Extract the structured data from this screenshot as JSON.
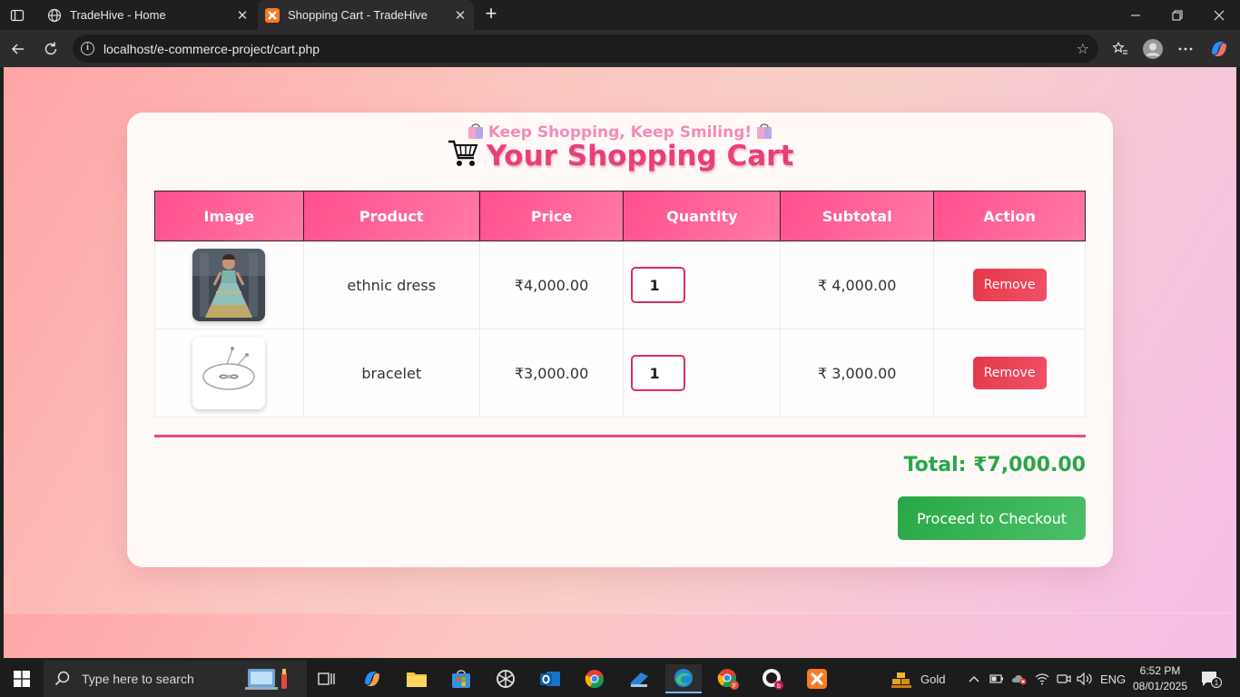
{
  "browser": {
    "tabs": [
      {
        "title": "TradeHive - Home",
        "active": false
      },
      {
        "title": "Shopping Cart - TradeHive",
        "active": true
      }
    ],
    "url": "localhost/e-commerce-project/cart.php"
  },
  "page": {
    "tagline": "Keep Shopping, Keep Smiling!",
    "heading": "Your Shopping Cart",
    "columns": [
      "Image",
      "Product",
      "Price",
      "Quantity",
      "Subtotal",
      "Action"
    ],
    "rows": [
      {
        "product": "ethnic dress",
        "price": "₹4,000.00",
        "quantity": "1",
        "subtotal": "₹ 4,000.00",
        "action": "Remove"
      },
      {
        "product": "bracelet",
        "price": "₹3,000.00",
        "quantity": "1",
        "subtotal": "₹ 3,000.00",
        "action": "Remove"
      }
    ],
    "total": "Total: ₹7,000.00",
    "checkout_label": "Proceed to Checkout",
    "colors": {
      "accent": "#ea3e78",
      "header_start": "#ff4f8e",
      "total": "#28a745",
      "remove": "#e5374a",
      "checkout": "#28a745"
    }
  },
  "taskbar": {
    "search_placeholder": "Type here to search",
    "weather": "Gold",
    "language": "ENG",
    "time": "6:52 PM",
    "date": "08/01/2025",
    "notifications": "1"
  }
}
